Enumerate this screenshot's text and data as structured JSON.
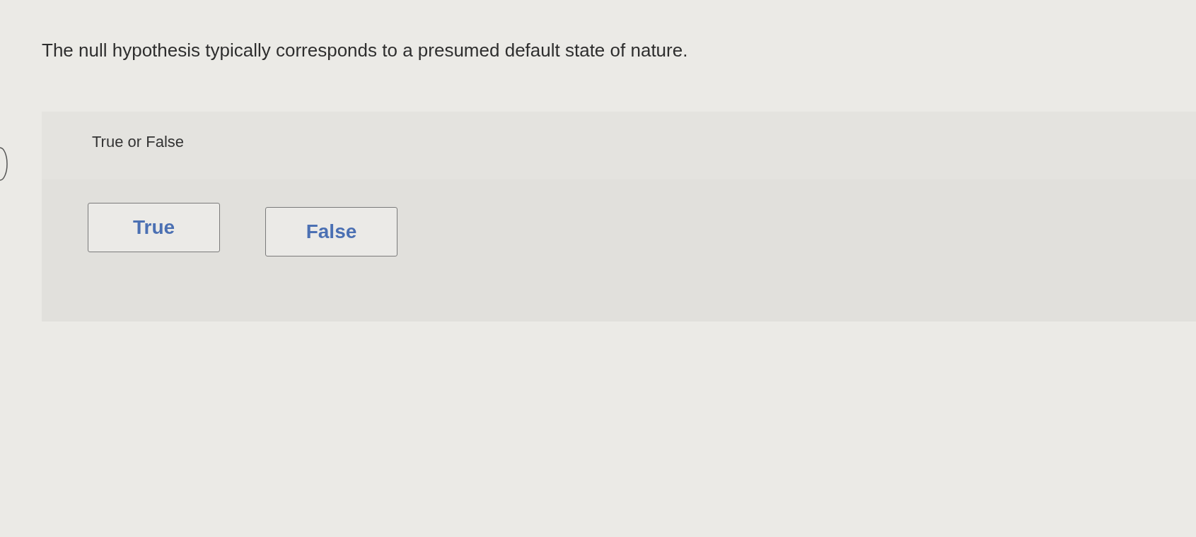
{
  "question": {
    "text": "The null hypothesis typically corresponds to a presumed default state of nature."
  },
  "answer_panel": {
    "prompt": "True or False",
    "options": [
      {
        "label": "True",
        "selected": false
      },
      {
        "label": "False",
        "selected": false
      }
    ]
  }
}
